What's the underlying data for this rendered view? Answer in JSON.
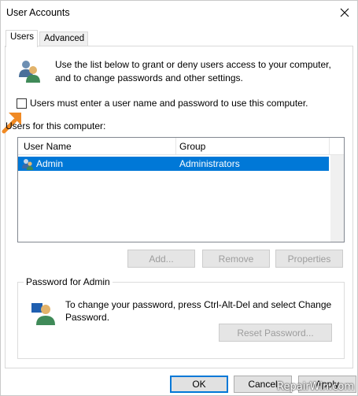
{
  "window": {
    "title": "User Accounts"
  },
  "tabs": [
    {
      "label": "Users",
      "active": true
    },
    {
      "label": "Advanced",
      "active": false
    }
  ],
  "intro": {
    "text": "Use the list below to grant or deny users access to your computer, and to change passwords and other settings."
  },
  "require_login": {
    "label": "Users must enter a user name and password to use this computer.",
    "checked": false
  },
  "users_list": {
    "caption": "Users for this computer:",
    "columns": [
      "User Name",
      "Group"
    ],
    "rows": [
      {
        "name": "Admin",
        "group": "Administrators",
        "selected": true
      }
    ]
  },
  "list_buttons": {
    "add": "Add...",
    "remove": "Remove",
    "properties": "Properties"
  },
  "password_group": {
    "legend": "Password for Admin",
    "text": "To change your password, press Ctrl-Alt-Del and select Change Password.",
    "reset_button": "Reset Password..."
  },
  "footer": {
    "ok": "OK",
    "cancel": "Cancel",
    "apply": "Apply"
  },
  "watermark": "RepairWin.com",
  "colors": {
    "selection": "#0078d7",
    "annotation_arrow": "#f08a24"
  }
}
